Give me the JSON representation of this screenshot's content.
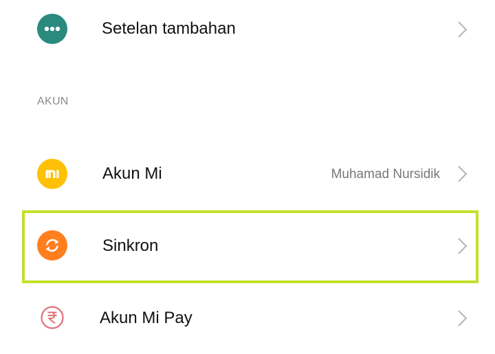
{
  "section_top": {
    "items": [
      {
        "label": "Setelan tambahan",
        "icon": "more-dots-icon",
        "icon_color": "#2a8a7e"
      }
    ]
  },
  "section_account": {
    "header": "AKUN",
    "items": [
      {
        "label": "Akun Mi",
        "value": "Muhamad Nursidik",
        "icon": "mi-logo-icon",
        "icon_color": "#ffc107"
      },
      {
        "label": "Sinkron",
        "icon": "sync-icon",
        "icon_color": "#ff7f1f",
        "highlighted": true
      },
      {
        "label": "Akun Mi Pay",
        "icon": "rupee-icon",
        "icon_color": "#e0707a"
      }
    ]
  },
  "highlight_color": "#c2e12a"
}
